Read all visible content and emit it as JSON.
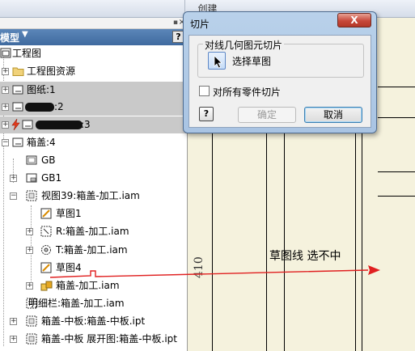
{
  "ribbon": {
    "title": "创建"
  },
  "browser": {
    "header": "模型",
    "help_label": "?",
    "items": [
      {
        "label": "工程图"
      },
      {
        "label": "工程图资源"
      },
      {
        "label": "图纸:1"
      },
      {
        "label": ":2"
      },
      {
        "label": ":3"
      },
      {
        "label": "箱盖:4"
      },
      {
        "label": "GB"
      },
      {
        "label": "GB1"
      },
      {
        "label": "视图39:箱盖-加工.iam"
      },
      {
        "label": "草图1"
      },
      {
        "label": "R:箱盖-加工.iam"
      },
      {
        "label": "T:箱盖-加工.iam"
      },
      {
        "label": "草图4"
      },
      {
        "label": "箱盖-加工.iam"
      },
      {
        "label": "明细栏:箱盖-加工.iam"
      },
      {
        "label": "箱盖-中板:箱盖-中板.ipt"
      },
      {
        "label": "箱盖-中板 展开图:箱盖-中板.ipt"
      }
    ]
  },
  "drawing": {
    "annotation": "草图线 选不中",
    "dimension": "410",
    "arrow_color": "#e02020"
  },
  "dialog": {
    "title": "切片",
    "close_label": "X",
    "group_title": "对线几何图元切片",
    "select_label": "选择草图",
    "checkbox_label": "对所有零件切片",
    "checkbox_checked": false,
    "help_label": "?",
    "ok_label": "确定",
    "cancel_label": "取消"
  }
}
